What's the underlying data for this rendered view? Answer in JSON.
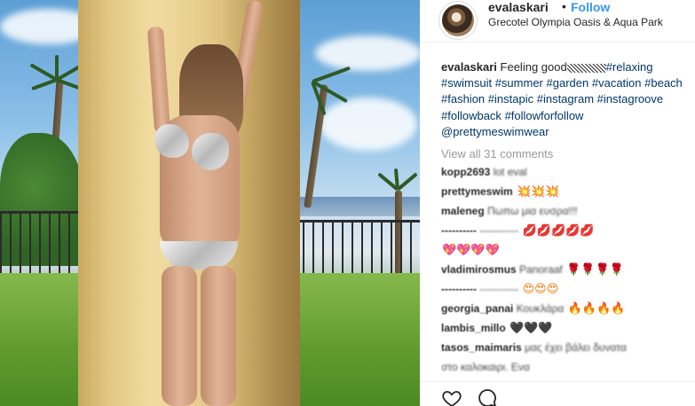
{
  "post": {
    "username": "evalaskari",
    "separator": "•",
    "follow_label": "Follow",
    "location": "Grecotel Olympia Oasis & Aqua Park",
    "caption_user": "evalaskari",
    "caption_text": "Feeling good",
    "caption_tags": [
      "#relaxing",
      "#swimsuit",
      "#summer",
      "#garden",
      "#vacation",
      "#beach",
      "#fashion",
      "#instapic",
      "#instagram",
      "#instagroove",
      "#followback",
      "#followforfollow",
      "@prettymeswimwear"
    ],
    "view_all_label": "View all 31 comments",
    "comments": [
      {
        "user": "kopp2693",
        "text": "lot eval"
      },
      {
        "user": "prettymeswim",
        "text": "",
        "emoji": "💥💥💥",
        "emoji_class": "anger"
      },
      {
        "user": "maleneg",
        "text": "Πωπω μια ευσρα!!!",
        "emoji": "",
        "emoji_class": ""
      },
      {
        "user": "----------",
        "text": "-----------",
        "emoji": "💋💋💋💋💋",
        "emoji_class": "lips"
      },
      {
        "user": "",
        "text": "",
        "emoji": "💖💖💖💖",
        "emoji_class": "heart"
      },
      {
        "user": "vladimirosmus",
        "text": "Panoraaf",
        "emoji": "🌹🌹🌹🌹",
        "emoji_class": "rose"
      },
      {
        "user": "----------",
        "text": "-----------",
        "emoji": "😍😍😍",
        "emoji_class": "fire"
      },
      {
        "user": "georgia_panai",
        "text": "Κουκλάρα",
        "emoji": "🔥🔥🔥🔥",
        "emoji_class": "fire"
      },
      {
        "user": "lambis_millo",
        "text": "",
        "emoji": "🖤🖤🖤",
        "emoji_class": "blackheart"
      },
      {
        "user": "tasos_maimaris",
        "text": "μας έχει βάλει δυνατα",
        "emoji": "",
        "emoji_class": ""
      },
      {
        "user": "",
        "text": "στο καλοκαιρι. Ενα",
        "emoji": "",
        "emoji_class": ""
      }
    ]
  },
  "icons": {
    "like": "heart-outline-icon",
    "comment": "speech-bubble-icon"
  },
  "colors": {
    "link": "#3897f0",
    "hashtag": "#003569",
    "muted": "#999999"
  }
}
